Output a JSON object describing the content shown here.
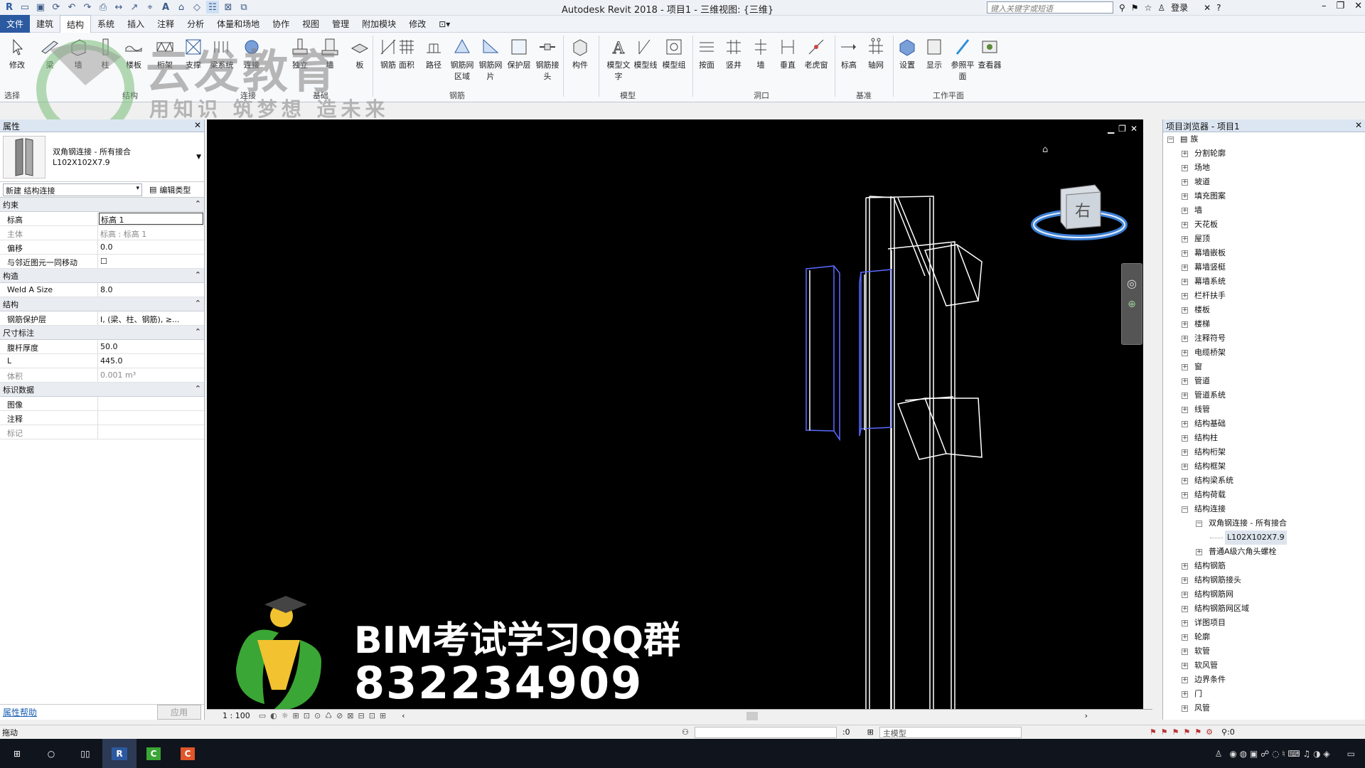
{
  "app": {
    "title": "Autodesk Revit 2018 -   项目1 - 三维视图: {三维}",
    "search_placeholder": "键入关键字或短语",
    "login": "登录"
  },
  "menu": {
    "tabs": [
      "文件",
      "建筑",
      "结构",
      "系统",
      "插入",
      "注释",
      "分析",
      "体量和场地",
      "协作",
      "视图",
      "管理",
      "附加模块",
      "修改"
    ],
    "active": "结构"
  },
  "ribbon": {
    "tools": [
      "修改",
      "梁",
      "墙",
      "柱",
      "楼板",
      "桁架",
      "支撑",
      "梁系统",
      "连接",
      "独立",
      "墙",
      "板",
      "钢筋",
      "面积",
      "路径",
      "钢筋网区域",
      "钢筋网片",
      "保护层",
      "钢筋接头",
      "构件",
      "模型文字",
      "模型线",
      "模型组",
      "按面",
      "竖井",
      "墙",
      "垂直",
      "老虎窗",
      "标高",
      "轴网",
      "设置",
      "显示",
      "参照平面",
      "查看器"
    ],
    "panels": [
      "选择",
      "结构",
      "连接",
      "基础",
      "钢筋",
      "模型",
      "洞口",
      "基准",
      "工作平面"
    ]
  },
  "properties": {
    "header": "属性",
    "type_name": "双角钢连接 - 所有接合",
    "type_sub": "L102X102X7.9",
    "filter": "新建 结构连接",
    "edit_type": "编辑类型",
    "groups": [
      {
        "name": "约束",
        "rows": [
          {
            "k": "标高",
            "v": "标高 1"
          },
          {
            "k": "主体",
            "v": "标高 : 标高 1",
            "ro": true
          },
          {
            "k": "偏移",
            "v": "0.0"
          },
          {
            "k": "与邻近图元一同移动",
            "v": "☐"
          }
        ]
      },
      {
        "name": "构造",
        "rows": [
          {
            "k": "Weld A Size",
            "v": "8.0"
          }
        ]
      },
      {
        "name": "结构",
        "rows": [
          {
            "k": "钢筋保护层",
            "v": "I, (梁、柱、钢筋), ≥..."
          }
        ]
      },
      {
        "name": "尺寸标注",
        "rows": [
          {
            "k": "腹杆厚度",
            "v": "50.0"
          },
          {
            "k": "L",
            "v": "445.0"
          },
          {
            "k": "体积",
            "v": "0.001 m³",
            "ro": true
          }
        ]
      },
      {
        "name": "标识数据",
        "rows": [
          {
            "k": "图像",
            "v": ""
          },
          {
            "k": "注释",
            "v": ""
          },
          {
            "k": "标记",
            "v": "",
            "ro": true
          }
        ]
      }
    ],
    "help": "属性帮助",
    "apply": "应用"
  },
  "view": {
    "scale": "1 : 100",
    "cube_label": "右"
  },
  "watermark": {
    "brand": "云发教育",
    "slogan": "用知识 筑梦想 造未来",
    "qq_title": "BIM考试学习QQ群",
    "qq_number": "832234909"
  },
  "browser": {
    "header": "项目浏览器 - 项目1",
    "root": "族",
    "items": [
      "分割轮廓",
      "场地",
      "坡道",
      "填充图案",
      "墙",
      "天花板",
      "屋顶",
      "幕墙嵌板",
      "幕墙竖梃",
      "幕墙系统",
      "栏杆扶手",
      "楼板",
      "楼梯",
      "注释符号",
      "电缆桥架",
      "窗",
      "管道",
      "管道系统",
      "线管",
      "结构基础",
      "结构柱",
      "结构桁架",
      "结构框架",
      "结构梁系统",
      "结构荷载",
      "结构连接"
    ],
    "sub_open": "双角钢连接 - 所有接合",
    "sub_leaf": "L102X102X7.9",
    "sub_other": "普通A级六角头螺栓",
    "items_after": [
      "结构钢筋",
      "结构钢筋接头",
      "结构钢筋网",
      "结构钢筋网区域",
      "详图项目",
      "轮廓",
      "软管",
      "软风管",
      "边界条件",
      "门",
      "风管"
    ]
  },
  "status": {
    "left": "拖动",
    "count": ":0",
    "model": "主模型",
    "filter": ":0"
  }
}
